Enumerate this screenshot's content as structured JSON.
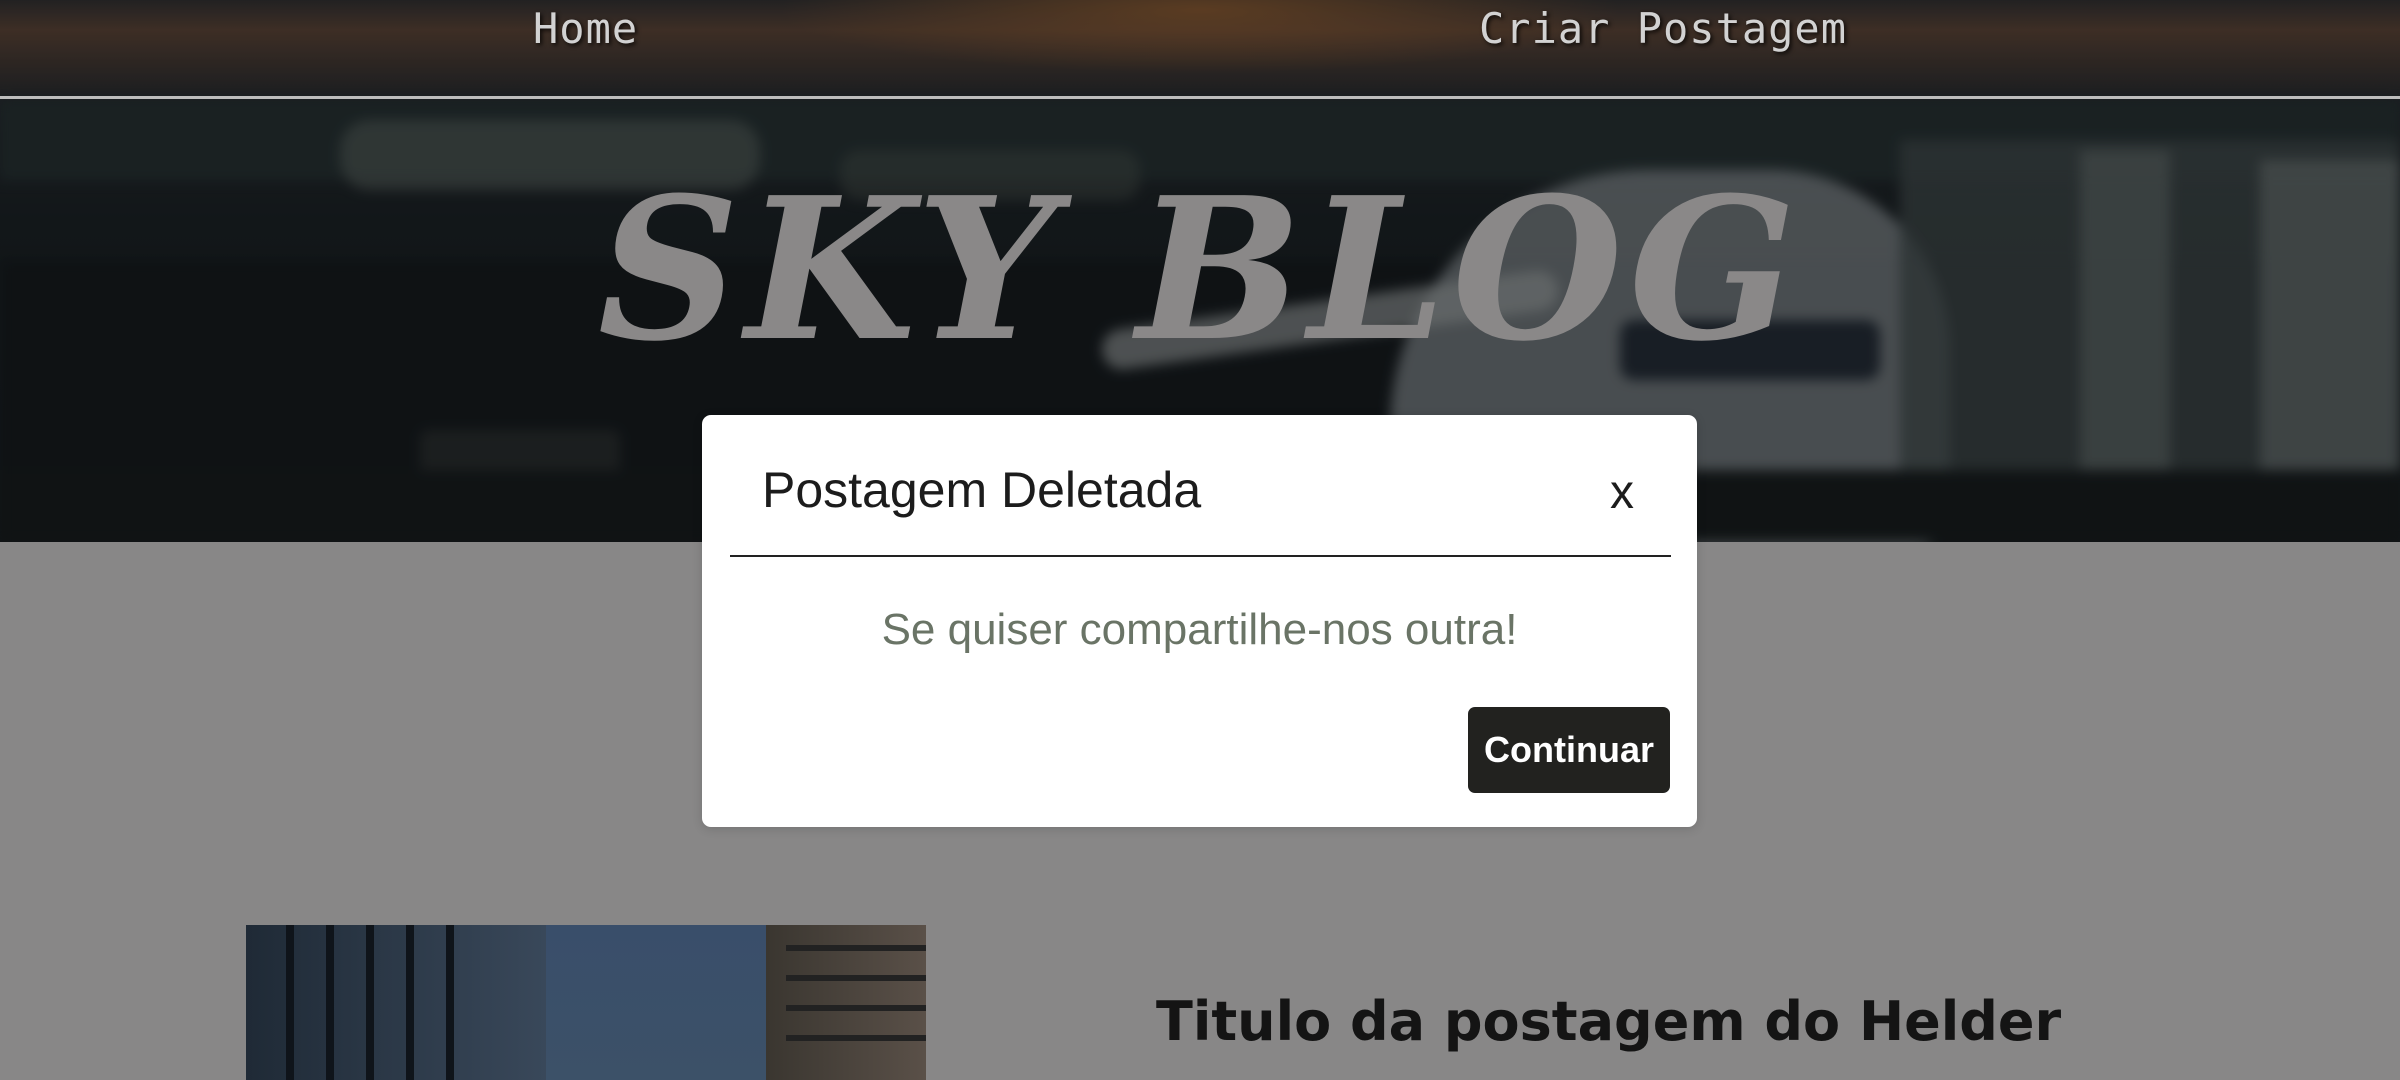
{
  "nav": {
    "items": [
      {
        "label": "Home"
      },
      {
        "label": "Criar Postagem"
      }
    ]
  },
  "hero": {
    "brand": "SKY BLOG"
  },
  "modal": {
    "title": "Postagem Deletada",
    "close_label": "x",
    "message": "Se quiser compartilhe-nos outra!",
    "button_label": "Continuar"
  },
  "post": {
    "title": "Titulo da postagem do Helder"
  }
}
